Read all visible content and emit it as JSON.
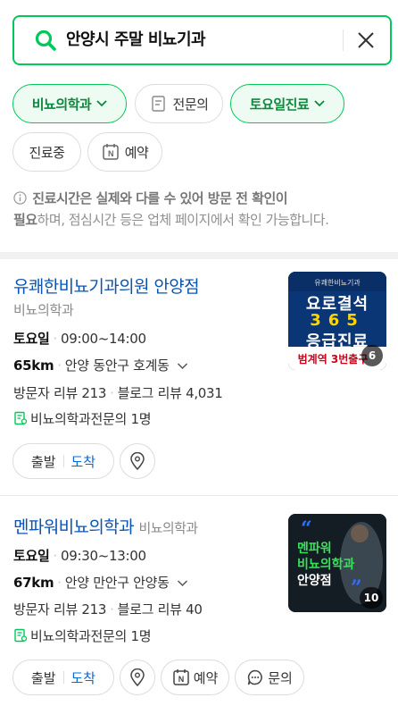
{
  "search": {
    "query": "안양시 주말 비뇨기과"
  },
  "filters": {
    "chip1": "비뇨의학과",
    "chip2": "전문의",
    "chip3": "토요일진료",
    "chip4": "진료중",
    "chip5": "예약"
  },
  "notice": {
    "bold1": "진료시간은 실제와 다를 수 있어 방문 전 확인이",
    "bold2": "필요",
    "rest": "하며, 점심시간 등은 업체 페이지에서 확인 가능합니다."
  },
  "results": [
    {
      "name": "유쾌한비뇨기과의원 안양점",
      "category": "비뇨의학과",
      "day": "토요일",
      "hours": "09:00~14:00",
      "distance": "65km",
      "address": "안양 동안구 호계동",
      "visitor_reviews": "방문자 리뷰 213",
      "blog_reviews": "블로그 리뷰 4,031",
      "specialists": "비뇨의학과전문의 1명",
      "thumb_line1": "요로결석",
      "thumb_line2": "365",
      "thumb_line3": "응급진료",
      "thumb_line4": "범계역 3번출구",
      "thumb_count": "6",
      "depart": "출발",
      "arrive": "도착"
    },
    {
      "name": "멘파워비뇨의학과",
      "category": "비뇨의학과",
      "day": "토요일",
      "hours": "09:30~13:00",
      "distance": "67km",
      "address": "안양 만안구 안양동",
      "visitor_reviews": "방문자 리뷰 213",
      "blog_reviews": "블로그 리뷰 40",
      "specialists": "비뇨의학과전문의 1명",
      "thumb_line1": "멘파워",
      "thumb_line2": "비뇨의학과",
      "thumb_line3": "안양점",
      "thumb_count": "10",
      "depart": "출발",
      "arrive": "도착",
      "reserve": "예약",
      "inquiry": "문의"
    }
  ],
  "colors": {
    "accent": "#03c75a",
    "link": "#0a54b3"
  }
}
